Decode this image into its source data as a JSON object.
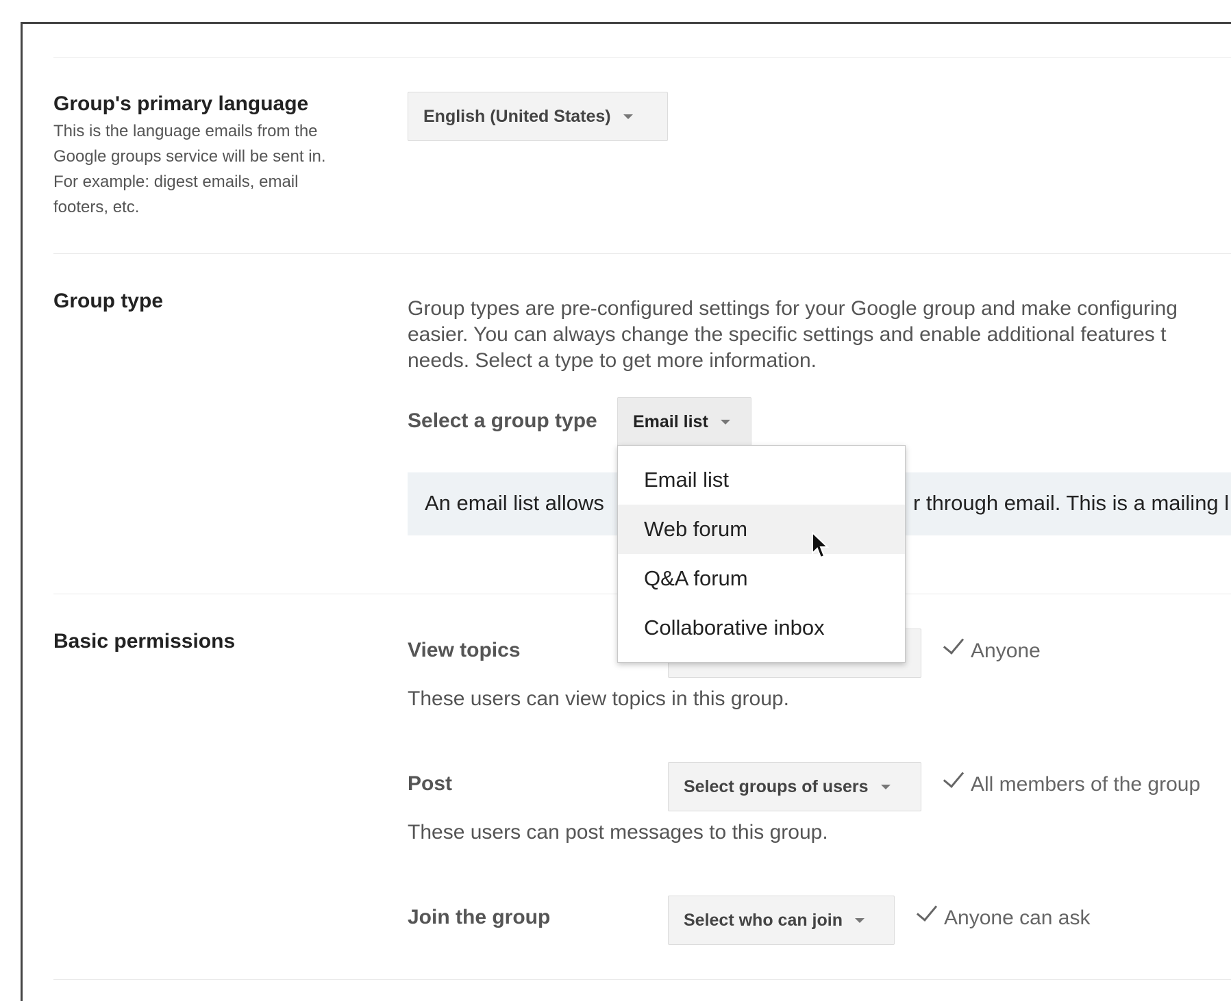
{
  "language": {
    "label": "Group's primary language",
    "description_lines": [
      "This is the language emails from the",
      "Google groups service will be sent in.",
      "For example: digest emails, email",
      "footers, etc."
    ],
    "selected": "English (United States)"
  },
  "group_type": {
    "label": "Group type",
    "description_lines": [
      "Group types are pre-configured settings for your Google group and make configuring",
      "easier. You can always change the specific settings and enable additional features t",
      "needs. Select a type to get more information."
    ],
    "select_label": "Select a group type",
    "selected": "Email list",
    "info_left": "An email list allows",
    "info_right": "r through email. This is a mailing l",
    "menu_items": [
      "Email list",
      "Web forum",
      "Q&A forum",
      "Collaborative inbox"
    ]
  },
  "permissions": {
    "label": "Basic permissions",
    "view": {
      "label": "View topics",
      "value": "Anyone",
      "description": "These users can view topics in this group."
    },
    "post": {
      "label": "Post",
      "select": "Select groups of users",
      "value": "All members of the group",
      "description": "These users can post messages to this group."
    },
    "join": {
      "label": "Join the group",
      "select": "Select who can join",
      "value": "Anyone can ask"
    }
  }
}
